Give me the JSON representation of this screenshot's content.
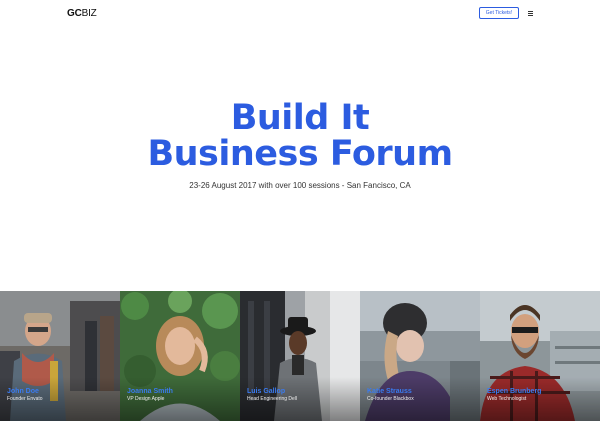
{
  "header": {
    "logo_bold": "GC",
    "logo_light": "BIZ",
    "tickets_label": "Get Tickets!",
    "menu_icon": "hamburger-menu-icon"
  },
  "hero": {
    "title_line1": "Build It",
    "title_line2": "Business Forum",
    "subtitle": "23-26 August 2017 with over 100 sessions - San Fancisco, CA"
  },
  "speakers": [
    {
      "name": "John Doe",
      "role": "Founder Envato"
    },
    {
      "name": "Joanna Smith",
      "role": "VP Design Apple"
    },
    {
      "name": "Luis Gallop",
      "role": "Head Engineering Dell"
    },
    {
      "name": "Katie Strauss",
      "role": "Co-founder Blackbox"
    },
    {
      "name": "Espen Brunberg",
      "role": "Web Technologist"
    }
  ],
  "colors": {
    "accent": "#2c5ce0",
    "speaker_name": "#3a7bf0"
  }
}
